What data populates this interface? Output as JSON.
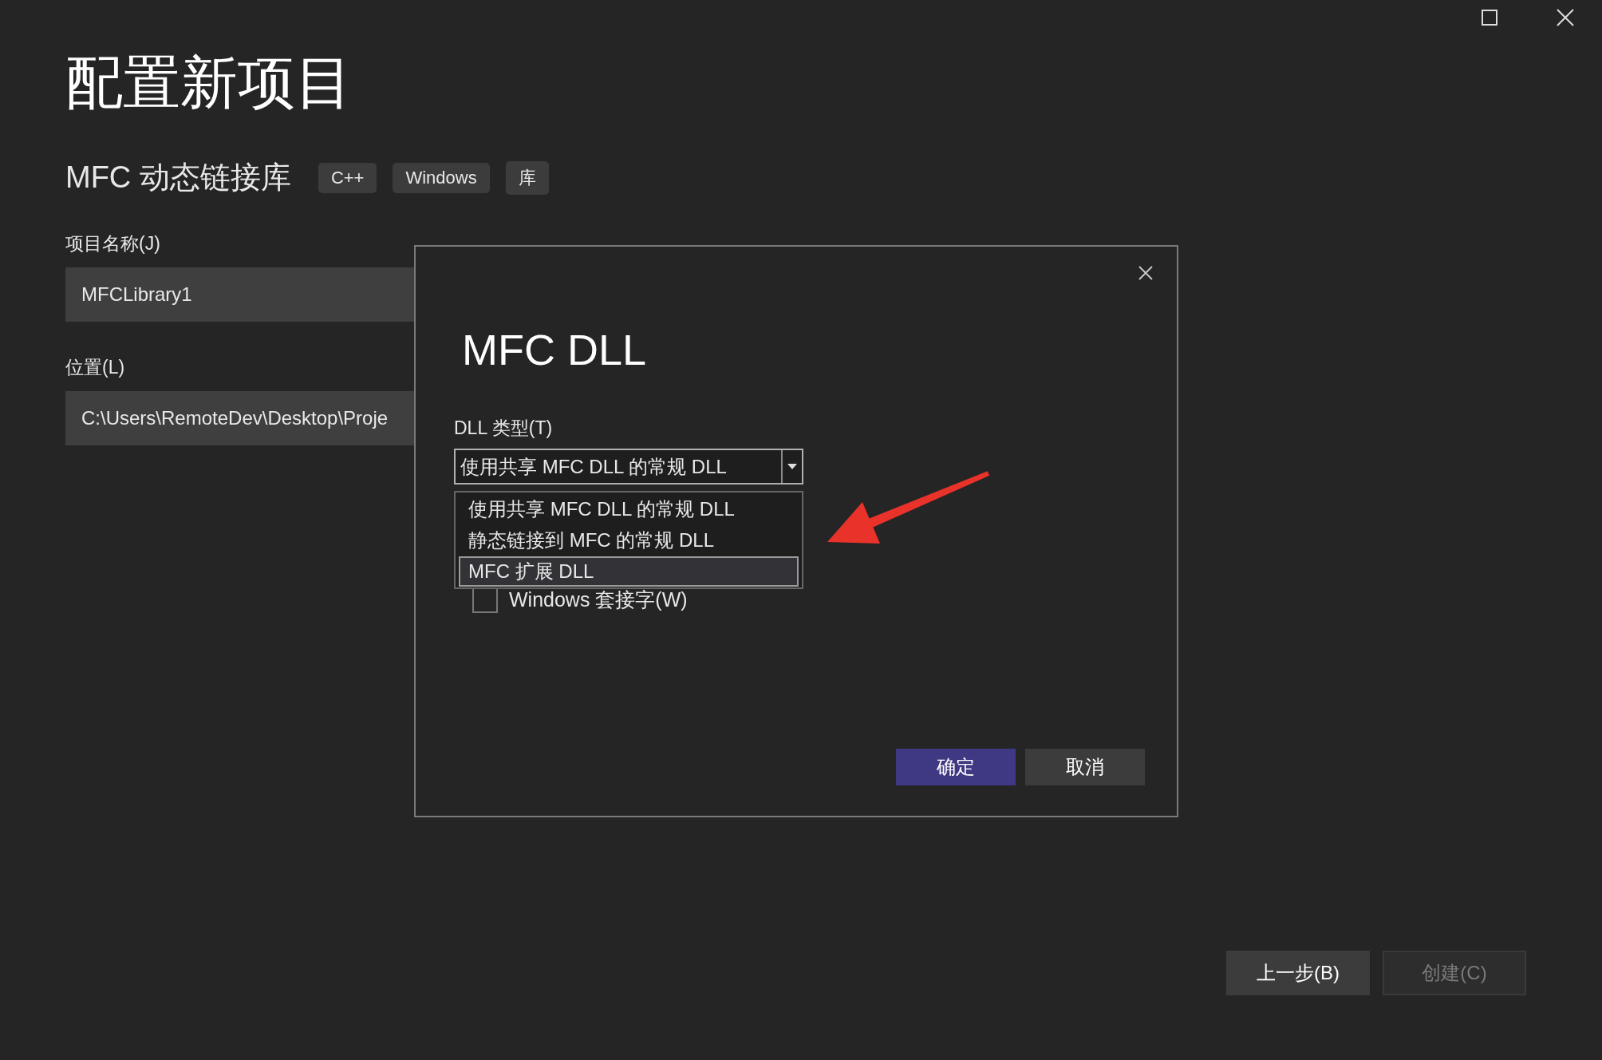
{
  "window": {
    "title": "配置新项目"
  },
  "template": {
    "name": "MFC 动态链接库",
    "tags": [
      "C++",
      "Windows",
      "库"
    ]
  },
  "fields": [
    {
      "label": "项目名称(J)",
      "value": "MFCLibrary1"
    },
    {
      "label": "位置(L)",
      "value": "C:\\Users\\RemoteDev\\Desktop\\Proje"
    }
  ],
  "dialog": {
    "title": "MFC DLL",
    "dll_type": {
      "label": "DLL 类型(T)",
      "value": "使用共享 MFC DLL 的常规 DLL",
      "expanded": true,
      "options": [
        {
          "label": "使用共享 MFC DLL 的常规 DLL",
          "highlighted": false
        },
        {
          "label": "静态链接到 MFC 的常规 DLL",
          "highlighted": false
        },
        {
          "label": "MFC 扩展 DLL",
          "highlighted": true
        }
      ]
    },
    "checkbox": {
      "label": "Windows 套接字(W)",
      "checked": false
    },
    "buttons": [
      {
        "label": "确定",
        "kind": "primary"
      },
      {
        "label": "取消",
        "kind": "secondary"
      }
    ]
  },
  "footer_buttons": [
    {
      "label": "上一步(B)",
      "disabled": false
    },
    {
      "label": "创建(C)",
      "disabled": true
    }
  ]
}
